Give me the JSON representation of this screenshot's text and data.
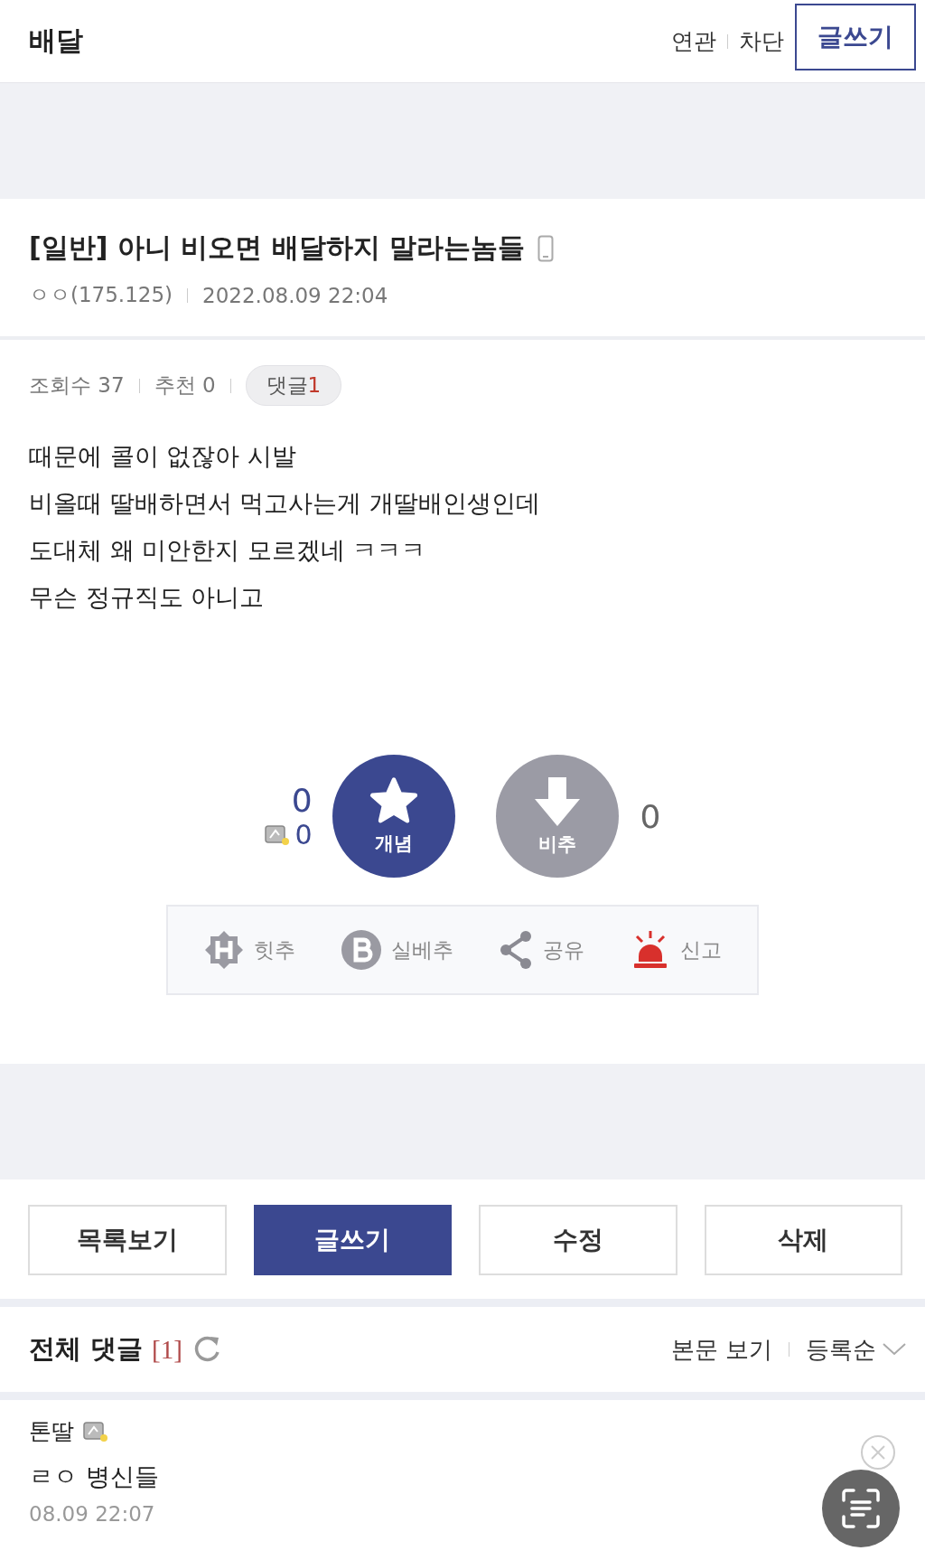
{
  "header": {
    "title": "배달",
    "links": [
      "연관",
      "차단"
    ],
    "write_button": "글쓰기"
  },
  "post": {
    "title": "[일반] 아니 비오면 배달하지 말라는놈들",
    "author": "ㅇㅇ(175.125)",
    "date": "2022.08.09 22:04",
    "stats": [
      {
        "label": "조회수 37"
      },
      {
        "label": "추천 0"
      }
    ],
    "comment_badge": {
      "label": "댓글",
      "count": "1"
    },
    "body": [
      "때문에 콜이 없잖아 시발",
      "비올때 딸배하면서 먹고사는게 개딸배인생인데",
      "도대체 왜 미안한지 모르겠네 ㅋㅋㅋ",
      "무슨 정규직도 아니고"
    ]
  },
  "votes": {
    "up_count": "0",
    "fixed_up_count": "0",
    "up_label": "개념",
    "down_label": "비추",
    "down_count": "0"
  },
  "actions": [
    {
      "kind": "hit",
      "label": "힛추"
    },
    {
      "kind": "best",
      "label": "실베추"
    },
    {
      "kind": "share",
      "label": "공유"
    },
    {
      "kind": "report",
      "label": "신고"
    }
  ],
  "buttons": [
    {
      "label": "목록보기",
      "kind": "default"
    },
    {
      "label": "글쓰기",
      "kind": "primary"
    },
    {
      "label": "수정",
      "kind": "default"
    },
    {
      "label": "삭제",
      "kind": "default"
    }
  ],
  "comments": {
    "title": "전체 댓글",
    "count": "[1]",
    "view_post": "본문 보기",
    "sort": "등록순",
    "items": [
      {
        "author": "톤딸",
        "text": "ㄹㅇ 병신들",
        "time": "08.09 22:07"
      }
    ]
  }
}
